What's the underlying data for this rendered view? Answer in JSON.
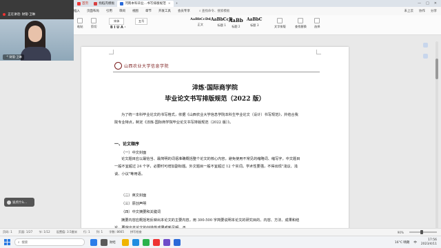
{
  "tabs": {
    "home": "首页",
    "draft": "找稻壳模板",
    "doc": "河南本科毕业...书写排版规范",
    "close": "×",
    "plus": "+"
  },
  "window_controls": [
    "—",
    "□",
    "✕"
  ],
  "menu": {
    "file": "三 文件",
    "items": [
      "开始",
      "插入",
      "页面布局",
      "引用",
      "审阅",
      "视图",
      "章节",
      "开发工具",
      "会员专享"
    ],
    "search": "查找命令、搜索模板",
    "right": [
      "未上云",
      "协作",
      "分享"
    ]
  },
  "ribbon": {
    "paste": "粘贴",
    "cut": "剪切",
    "font_name": "宋体",
    "font_size": "五号",
    "styles": [
      {
        "preview": "AaBbCcDd",
        "label": "正文"
      },
      {
        "preview": "AaBbCcD",
        "label": "标题 1"
      },
      {
        "preview": "AaBb",
        "label": "标题 2"
      },
      {
        "preview": "AaBbC",
        "label": "标题 3"
      }
    ],
    "text_tools": "文字排版",
    "find_replace": "查找替换",
    "select": "选择"
  },
  "meeting": {
    "status": "正在讲话: 财管-卫琳",
    "participant": "财管-卫琳",
    "chat": "说点什么..."
  },
  "document": {
    "logo_text": "山西农业大学信息学院",
    "title1": "淬炼·国际商学院",
    "title2": "毕业论文书写排版规范（2022 版）",
    "intro": "为了统一本科毕业论文的书写格式，依据《山西农业大学信息学院本科生毕业论文（设计）书写规范》，并结合我院专业特点，制定《淬炼·国际商学院毕业论文书写排版规范（2022 版）》。",
    "section1": "一、论文顺序",
    "sub1": "（一）中文封面",
    "body1": "论文题目应以最恰当、最简明的词语准确概括整个论文的核心内容，避免使用不常见的缩略词、缩写字，中文题目一般不宜超过 24 个字，必要时可增加副标题。外文题目一般不宜超过 12 个实词。学术性要强，不得出现\"浅议、浅谈、小议\"等用语。",
    "sub2": "（二）英文封面",
    "sub3": "（三）原创声明",
    "sub4": "（四）中文摘要和关键词",
    "body2": "摘要内容应概括地反映出本论文的主要内容，用 300-500 字简要说明本论文的研究目的、内容、方法、成果和结论，要突出本论文的创造性成果或新见解。不"
  },
  "status": {
    "page": "页码: 1",
    "pages": "页面: 1/27",
    "section": "节: 1/12",
    "position": "设置值: 3.5厘米",
    "row": "行: 1",
    "col": "列: 1",
    "words": "字数: 8665",
    "spell": "拼写检查",
    "zoom": "90%",
    "zoom_fraction": 0.45
  },
  "taskbar": {
    "search": "搜索",
    "app_label": "财经",
    "weather": "16°C 晴朗",
    "time": "17:56",
    "date": "2023/4/11",
    "lang": "中"
  },
  "colors": {
    "accent": "#2a6ad8",
    "logo": "#7a1a1a",
    "record": "#e33333"
  }
}
